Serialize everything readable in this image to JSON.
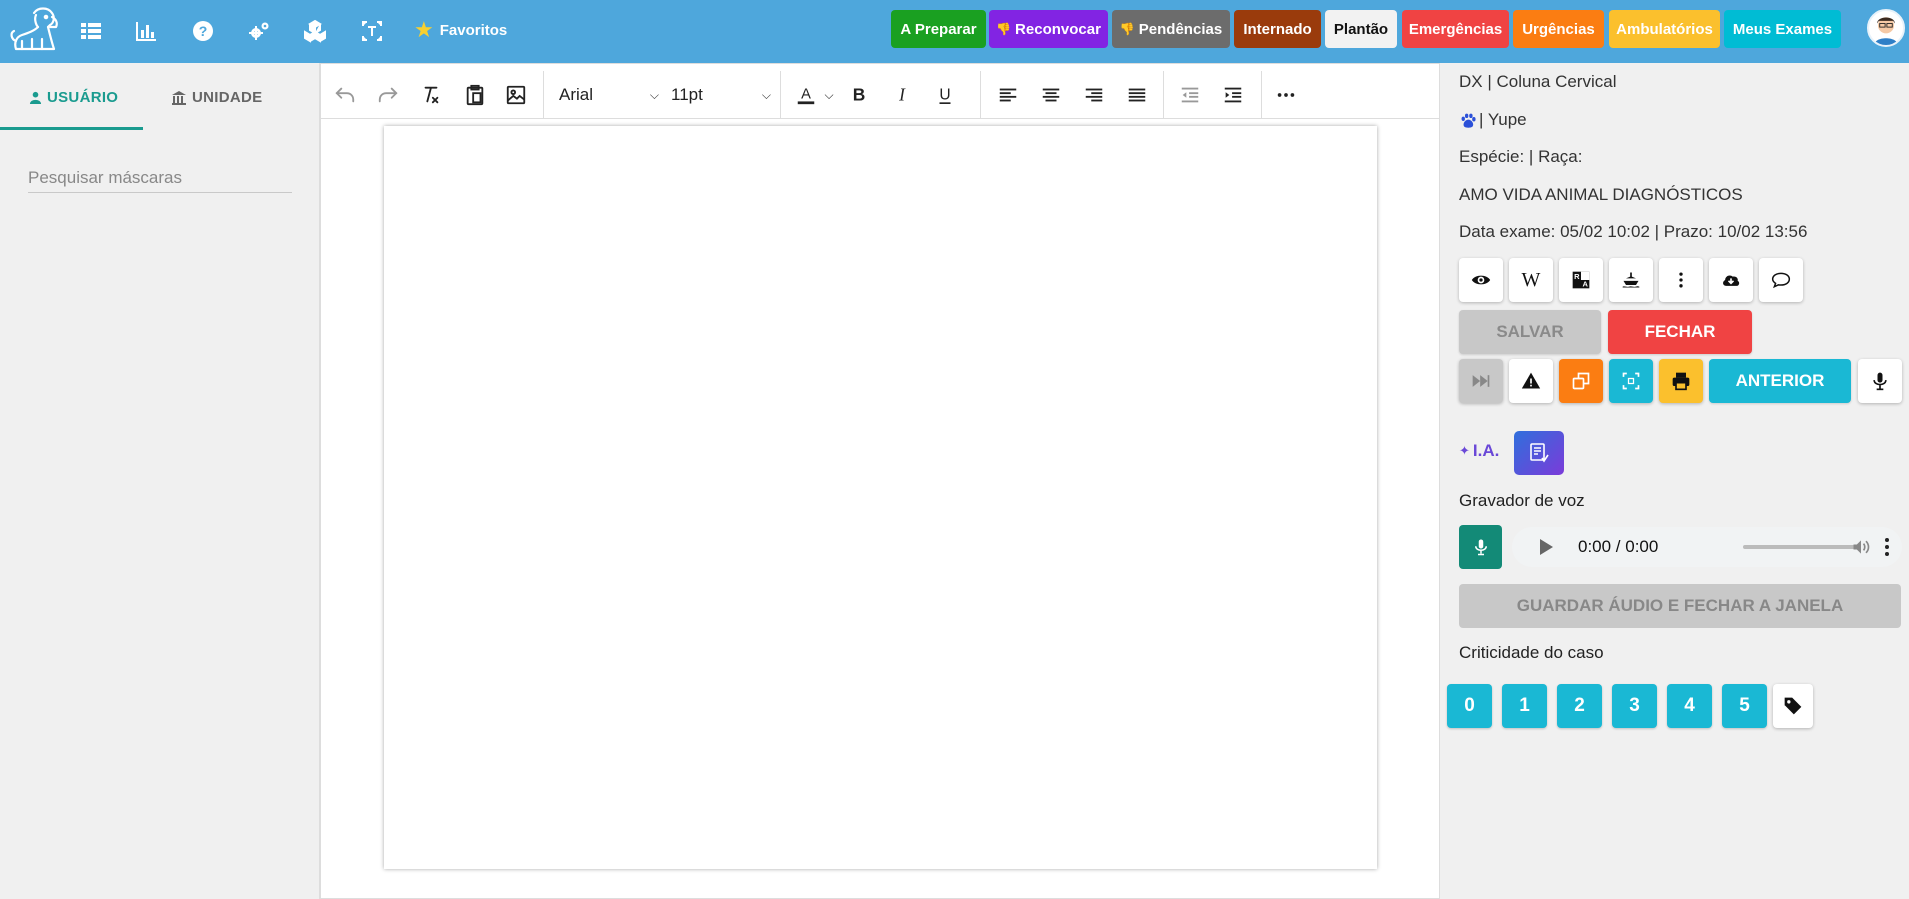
{
  "header": {
    "favorites_label": "Favoritos",
    "status_buttons": [
      {
        "label": "A Preparar",
        "color": "#1aa021"
      },
      {
        "label": "Reconvocar",
        "color": "#8224e3"
      },
      {
        "label": "Pendências",
        "color": "#6c6c6c"
      },
      {
        "label": "Internado",
        "color": "#9a3b0c"
      },
      {
        "label": "Plantão",
        "color": "#f2f2f2"
      },
      {
        "label": "Emergências",
        "color": "#f04343"
      },
      {
        "label": "Urgências",
        "color": "#fb7d12"
      },
      {
        "label": "Ambulatórios",
        "color": "#fbc02d"
      },
      {
        "label": "Meus Exames",
        "color": "#00bcd4"
      }
    ]
  },
  "left": {
    "tabs": [
      {
        "label": "USUÁRIO"
      },
      {
        "label": "UNIDADE"
      }
    ],
    "search_placeholder": "Pesquisar máscaras"
  },
  "editor": {
    "font_family": "Arial",
    "font_size": "11pt"
  },
  "exam": {
    "title": "DX | Coluna Cervical",
    "patient": "| Yupe",
    "species_breed": "Espécie: | Raça:",
    "clinic": "AMO VIDA ANIMAL DIAGNÓSTICOS",
    "dates": "Data exame: 05/02 10:02 | Prazo: 10/02 13:56"
  },
  "actions": {
    "save_label": "SALVAR",
    "close_label": "FECHAR",
    "previous_label": "ANTERIOR",
    "wiki_label": "W",
    "ai_label": "I.A."
  },
  "voice": {
    "title": "Gravador de voz",
    "time": "0:00 / 0:00",
    "save_button": "GUARDAR ÁUDIO E FECHAR A JANELA"
  },
  "criticality": {
    "title": "Criticidade do caso",
    "levels": [
      "0",
      "1",
      "2",
      "3",
      "4",
      "5"
    ]
  }
}
